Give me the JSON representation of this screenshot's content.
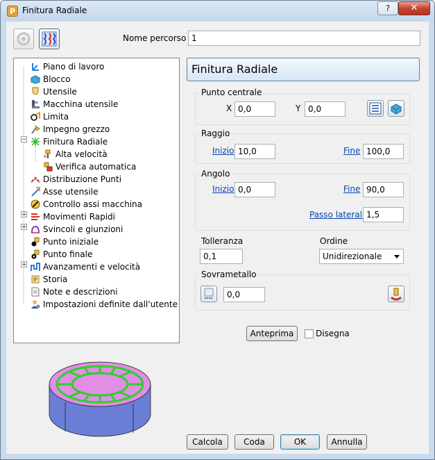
{
  "window": {
    "title": "Finitura Radiale",
    "help_glyph": "?",
    "close_glyph": "✕"
  },
  "toolbar": {
    "icons": [
      "disabled-gear-icon",
      "strategy-pattern-icon"
    ]
  },
  "nome_percorso": {
    "label": "Nome percorso",
    "value": "1"
  },
  "tree": {
    "items": [
      {
        "label": "Piano di lavoro",
        "icon": "workplane-icon"
      },
      {
        "label": "Blocco",
        "icon": "block-icon"
      },
      {
        "label": "Utensile",
        "icon": "tool-icon"
      },
      {
        "label": "Macchina utensile",
        "icon": "machine-tool-icon"
      },
      {
        "label": "Limita",
        "icon": "limit-icon"
      },
      {
        "label": "Impegno grezzo",
        "icon": "stock-engagement-icon"
      },
      {
        "label": "Finitura Radiale",
        "icon": "radial-finishing-icon"
      },
      {
        "label": "Alta velocità",
        "icon": "high-speed-icon"
      },
      {
        "label": "Verifica automatica",
        "icon": "auto-verify-icon"
      },
      {
        "label": "Distribuzione Punti",
        "icon": "point-distribution-icon"
      },
      {
        "label": "Asse utensile",
        "icon": "tool-axis-icon"
      },
      {
        "label": "Controllo assi macchina",
        "icon": "axis-control-icon"
      },
      {
        "label": "Movimenti Rapidi",
        "icon": "rapid-moves-icon"
      },
      {
        "label": "Svincoli e giunzioni",
        "icon": "leads-links-icon"
      },
      {
        "label": "Punto iniziale",
        "icon": "start-point-icon"
      },
      {
        "label": "Punto finale",
        "icon": "end-point-icon"
      },
      {
        "label": "Avanzamenti e velocità",
        "icon": "feeds-speeds-icon"
      },
      {
        "label": "Storia",
        "icon": "history-icon"
      },
      {
        "label": "Note e descrizioni",
        "icon": "notes-icon"
      },
      {
        "label": "Impostazioni definite dall'utente",
        "icon": "user-settings-icon"
      }
    ]
  },
  "panel": {
    "header": "Finitura Radiale",
    "punto_centrale": {
      "label": "Punto centrale",
      "x_label": "X",
      "x_value": "0,0",
      "y_label": "Y",
      "y_value": "0,0"
    },
    "raggio": {
      "label": "Raggio",
      "inizio_label": "Inizio",
      "inizio_value": "10,0",
      "fine_label": "Fine",
      "fine_value": "100,0"
    },
    "angolo": {
      "label": "Angolo",
      "inizio_label": "Inizio",
      "inizio_value": "0,0",
      "fine_label": "Fine",
      "fine_value": "90,0",
      "passo_label": "Passo laterale",
      "passo_value": "1,5"
    },
    "tolleranza": {
      "label": "Tolleranza",
      "value": "0,1"
    },
    "ordine": {
      "label": "Ordine",
      "value": "Unidirezionale"
    },
    "sovrametallo": {
      "label": "Sovrametallo",
      "value": "0,0"
    },
    "anteprima_label": "Anteprima",
    "disegna_label": "Disegna",
    "disegna_checked": false
  },
  "buttons": {
    "calcola": "Calcola",
    "coda": "Coda",
    "ok": "OK",
    "annulla": "Annulla"
  },
  "colors": {
    "accent_link": "#0645ad",
    "preview_top": "#e28ee4",
    "preview_toolpath": "#2bd12b",
    "preview_side": "#6b7ed6"
  }
}
